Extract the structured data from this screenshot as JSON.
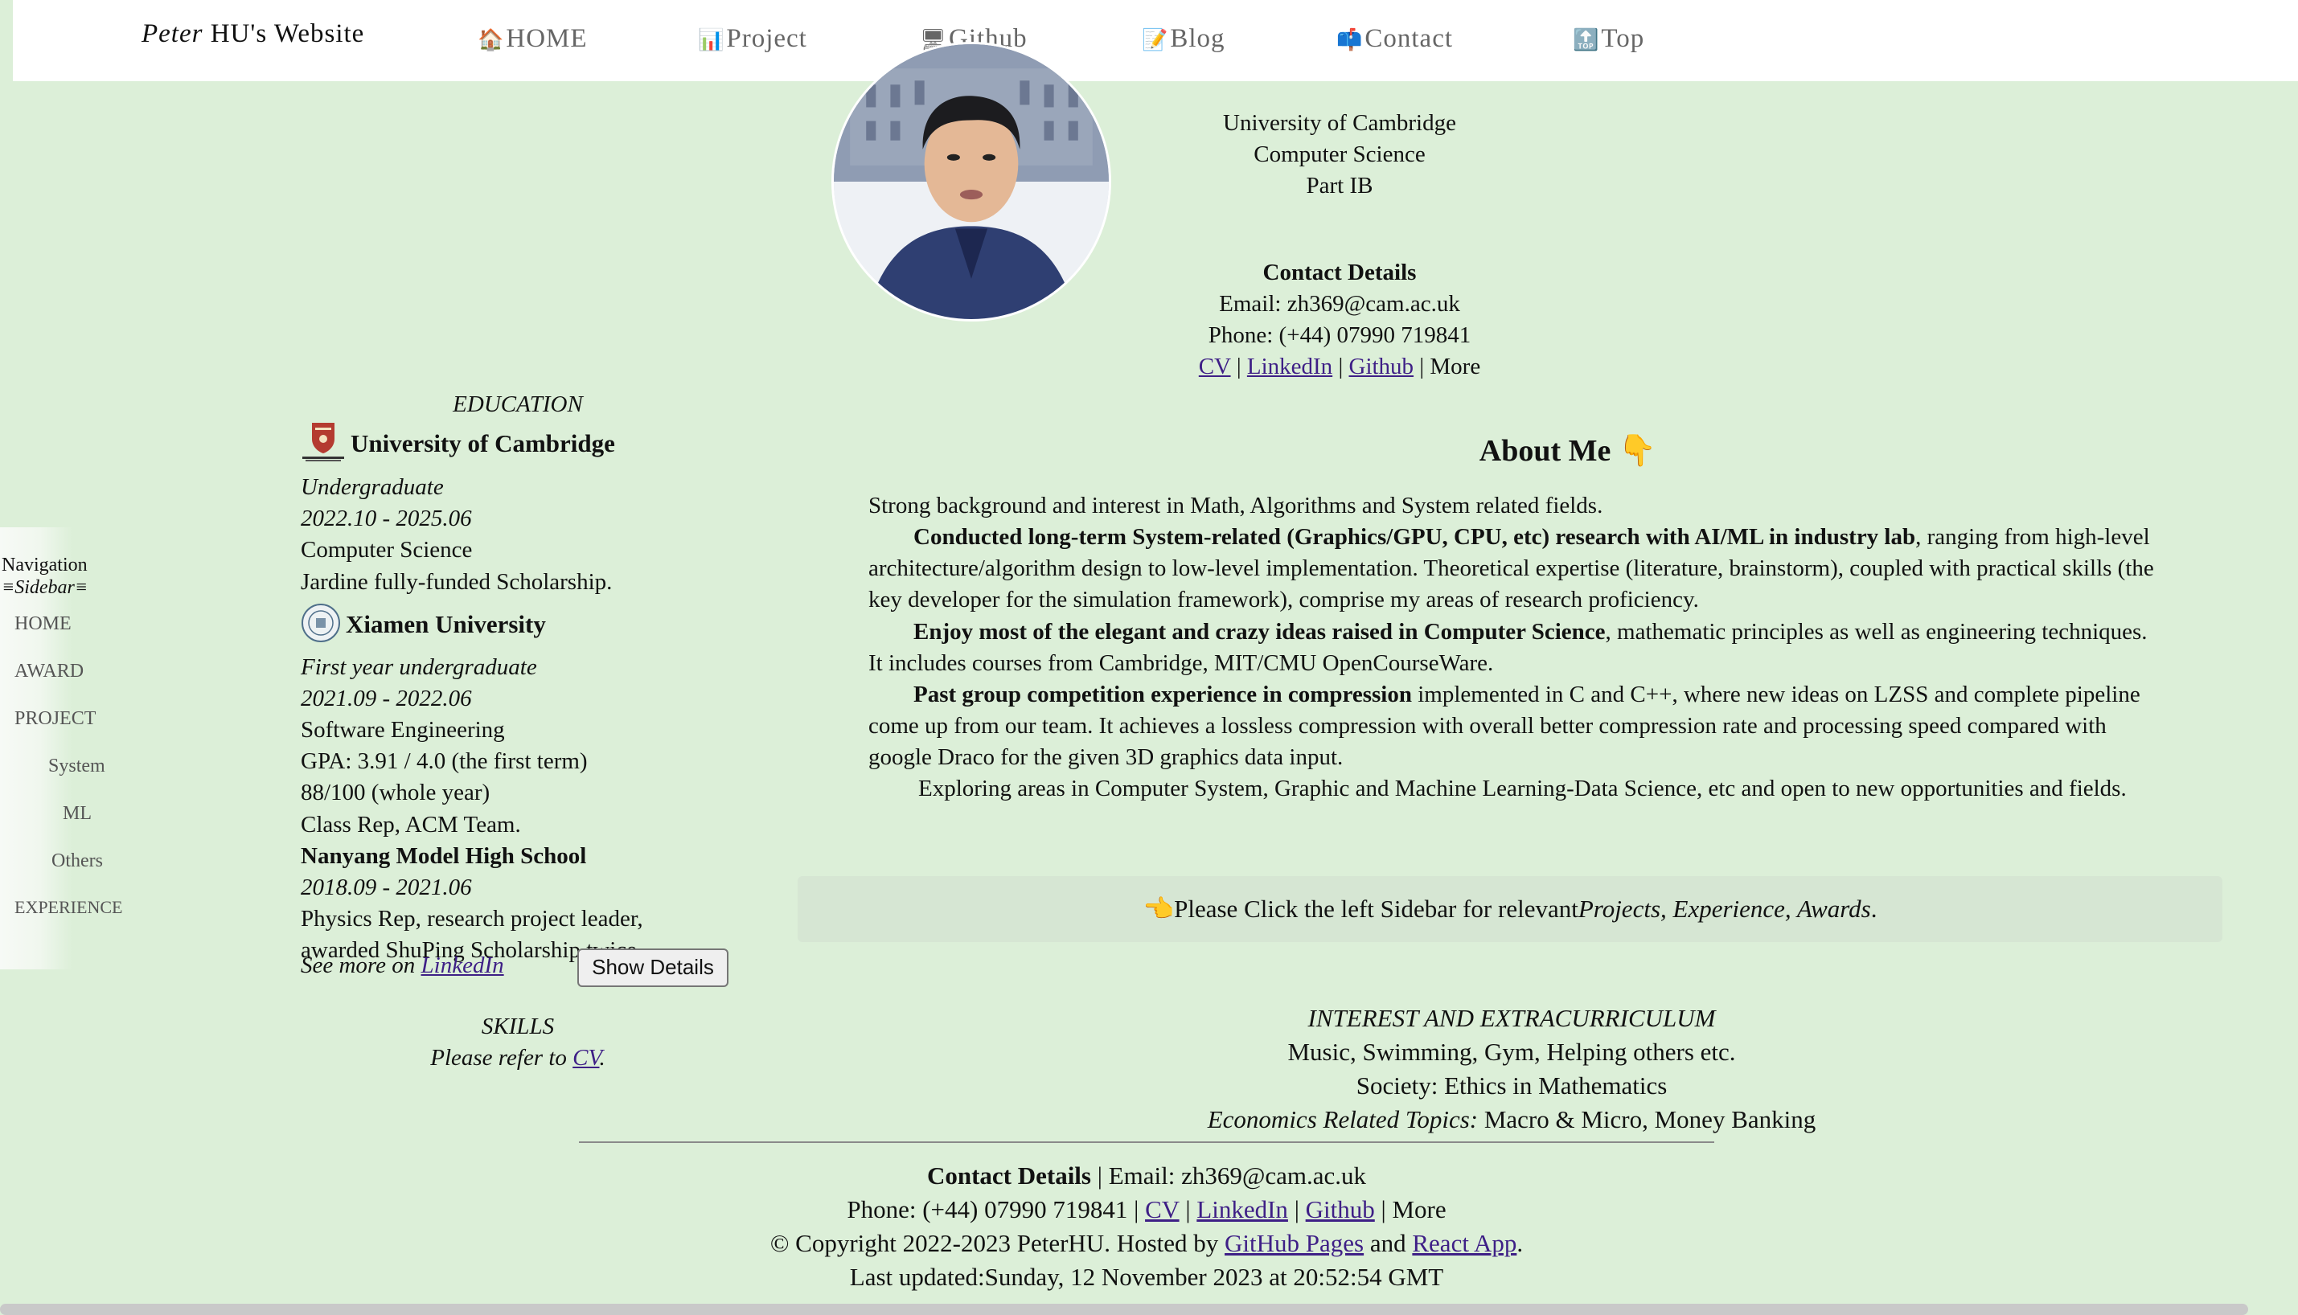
{
  "header": {
    "title_italic": "Peter",
    "title_rest": " HU's Website",
    "nav": [
      {
        "icon": "🏠",
        "label": "HOME"
      },
      {
        "icon": "📊",
        "label": "Project"
      },
      {
        "icon": "🖥",
        "label": "Github"
      },
      {
        "icon": "📝",
        "label": "Blog"
      },
      {
        "icon": "📫",
        "label": "Contact"
      },
      {
        "icon": "🔝",
        "label": "Top"
      }
    ]
  },
  "profile": {
    "line1": "University of Cambridge",
    "line2": "Computer Science",
    "line3": "Part IB"
  },
  "contact_top": {
    "heading": "Contact Details",
    "email": "Email: zh369@cam.ac.uk",
    "phone": "Phone: (+44) 07990 719841",
    "cv": "CV",
    "sep": " | ",
    "linkedin": "LinkedIn",
    "github": "Github",
    "more": "More"
  },
  "education": {
    "heading": "EDUCATION",
    "cambridge": {
      "name": "University of Cambridge",
      "degree": "Undergraduate",
      "dates": "2022.10 - 2025.06",
      "subject": "Computer Science",
      "note": "Jardine fully-funded Scholarship."
    },
    "xiamen": {
      "name": "Xiamen University",
      "degree": "First year undergraduate",
      "dates": "2021.09 - 2022.06",
      "subject": "Software Engineering",
      "gpa": "GPA: 3.91 / 4.0 (the first term)",
      "score": "88/100 (whole year)",
      "roles": "Class Rep, ACM Team."
    },
    "nanyang": {
      "name": "Nanyang Model High School",
      "dates": "2018.09 - 2021.06",
      "note1": "Physics Rep, research project leader,",
      "note2": "awarded ShuPing Scholarship twice."
    },
    "see_more": "See more on ",
    "see_more_link": "LinkedIn",
    "show_details": "Show Details"
  },
  "skills": {
    "heading": "SKILLS",
    "text": "Please refer to ",
    "link": "CV",
    "end": "."
  },
  "sidebar": {
    "title_line1": "Navigation",
    "title_line2": "≡Sidebar≡",
    "items": [
      "HOME",
      "AWARD",
      "PROJECT",
      "System",
      "ML",
      "Others",
      "EXPERIENCE"
    ]
  },
  "about": {
    "heading": "About Me",
    "heading_icon": "👇",
    "p1": "Strong background and interest in Math, Algorithms and System related fields.",
    "p2_bold": "Conducted long-term System-related (Graphics/GPU, CPU, etc) research with AI/ML in industry lab",
    "p2_rest": ", ranging from high-level architecture/algorithm design to low-level implementation. Theoretical expertise (literature, brainstorm), coupled with practical skills (the key developer for the simulation framework), comprise my areas of research proficiency.",
    "p3_bold": "Enjoy most of the elegant and crazy ideas raised in Computer Science",
    "p3_rest": ", mathematic principles as well as engineering techniques. It includes courses from Cambridge, MIT/CMU OpenCourseWare.",
    "p4_bold": "Past group competition experience in compression",
    "p4_rest": " implemented in C and C++, where new ideas on LZSS and complete pipeline come up from our team. It achieves a lossless compression with overall better compression rate and processing speed compared with google Draco for the given 3D graphics data input.",
    "p5": "Exploring areas in Computer System, Graphic and Machine Learning-Data Science, etc and open to new opportunities and fields."
  },
  "callout": {
    "icon": "👈",
    "text": " Please Click the left Sidebar for relevant ",
    "italic": "Projects, Experience, Awards",
    "end": "."
  },
  "interest": {
    "heading": "INTEREST AND EXTRACURRICULUM",
    "line1": "Music, Swimming, Gym, Helping others etc.",
    "line2": "Society: Ethics in Mathematics",
    "line3_italic": "Economics Related Topics:",
    "line3_rest": " Macro & Micro, Money Banking"
  },
  "footer": {
    "contact_bold": "Contact Details",
    "email": " | Email: zh369@cam.ac.uk",
    "phone": "Phone: (+44) 07990 719841 | ",
    "cv": "CV",
    "linkedin": " LinkedIn",
    "github": "Github",
    "more": " | More",
    "copyright": "© Copyright 2022-2023 PeterHU. Hosted by ",
    "gh_pages": "GitHub Pages",
    "and": " and ",
    "react": "React App",
    "period": ".",
    "updated": "Last updated:Sunday, 12 November 2023 at 20:52:54 GMT"
  }
}
